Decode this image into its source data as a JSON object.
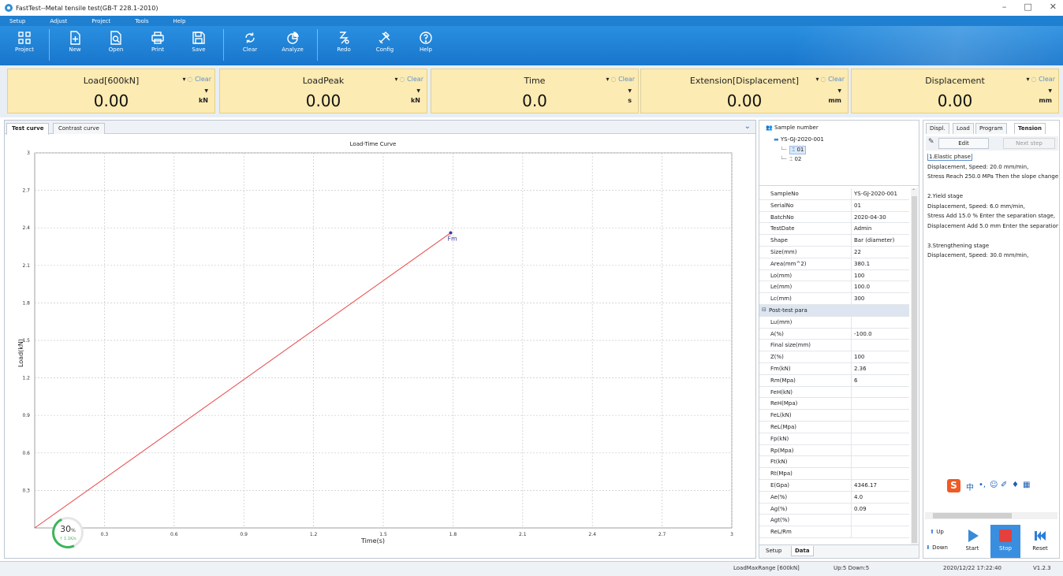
{
  "window": {
    "title": "FastTest--Metal tensile test(GB-T 228.1-2010)",
    "controls": [
      "–",
      "□",
      "✕"
    ]
  },
  "menu": [
    "Setup",
    "Adjust",
    "Project",
    "Tools",
    "Help"
  ],
  "toolbar": [
    {
      "label": "Project",
      "icon": "project-icon"
    },
    {
      "label": "New",
      "icon": "new-icon"
    },
    {
      "label": "Open",
      "icon": "open-icon"
    },
    {
      "label": "Print",
      "icon": "print-icon"
    },
    {
      "label": "Save",
      "icon": "save-icon"
    },
    {
      "label": "Clear",
      "icon": "clear-icon"
    },
    {
      "label": "Analyze",
      "icon": "analyze-icon"
    },
    {
      "label": "Redo",
      "icon": "redo-icon"
    },
    {
      "label": "Config",
      "icon": "config-icon"
    },
    {
      "label": "Help",
      "icon": "help-icon"
    }
  ],
  "panels": [
    {
      "name": "Load[600kN]",
      "value": "0.00",
      "unit": "kN",
      "clear": "Clear"
    },
    {
      "name": "LoadPeak",
      "value": "0.00",
      "unit": "kN",
      "clear": "Clear"
    },
    {
      "name": "Time",
      "value": "0.0",
      "unit": "s",
      "clear": "Clear"
    },
    {
      "name": "Extension[Displacement]",
      "value": "0.00",
      "unit": "mm",
      "clear": "Clear"
    },
    {
      "name": "Displacement",
      "value": "0.00",
      "unit": "mm",
      "clear": "Clear"
    }
  ],
  "left_tabs": [
    "Test curve",
    "Contrast curve"
  ],
  "chart_data": {
    "type": "line",
    "title": "Load-Time Curve",
    "xlabel": "Time(s)",
    "ylabel": "Load(kN)",
    "xlim": [
      0,
      3
    ],
    "ylim": [
      0,
      3
    ],
    "xticks": [
      "0.3",
      "0.6",
      "0.9",
      "1.2",
      "1.5",
      "1.8",
      "2.1",
      "2.4",
      "2.7",
      "3"
    ],
    "yticks": [
      "0.3",
      "0.6",
      "0.9",
      "1.2",
      "1.5",
      "1.8",
      "2.1",
      "2.4",
      "2.7",
      "3"
    ],
    "series": [
      {
        "color": "#e8494a",
        "x": [
          0,
          1.79
        ],
        "y": [
          0,
          2.36
        ]
      }
    ],
    "annotations": [
      {
        "label": "Fm",
        "x": 1.79,
        "y": 2.36,
        "color": "#3a3a9a"
      }
    ],
    "grid": true
  },
  "progress": {
    "percent": "30",
    "unit": "%",
    "rate": "↑ 1.1K/s"
  },
  "tree": {
    "root": "Sample number",
    "sample": "YS-GJ-2020-001",
    "items": [
      "01",
      "02"
    ]
  },
  "params": [
    {
      "k": "SampleNo",
      "v": "YS-GJ-2020-001"
    },
    {
      "k": "SerialNo",
      "v": "01"
    },
    {
      "k": "BatchNo",
      "v": "2020-04-30"
    },
    {
      "k": "TestDate",
      "v": "Admin"
    },
    {
      "k": "Shape",
      "v": "Bar (diameter)"
    },
    {
      "k": "Size(mm)",
      "v": "22"
    },
    {
      "k": "Area(mm^2)",
      "v": "380.1"
    },
    {
      "k": "Lo(mm)",
      "v": "100"
    },
    {
      "k": "Le(mm)",
      "v": "100.0"
    },
    {
      "k": "Lc(mm)",
      "v": "300"
    }
  ],
  "post_title": "Post-test para",
  "post": [
    {
      "k": "Lu(mm)",
      "v": ""
    },
    {
      "k": "A(%)",
      "v": "-100.0"
    },
    {
      "k": "Final size(mm)",
      "v": ""
    },
    {
      "k": "Z(%)",
      "v": "100"
    },
    {
      "k": "Fm(kN)",
      "v": "2.36"
    },
    {
      "k": "Rm(Mpa)",
      "v": "6"
    },
    {
      "k": "FeH(kN)",
      "v": ""
    },
    {
      "k": "ReH(Mpa)",
      "v": ""
    },
    {
      "k": "FeL(kN)",
      "v": ""
    },
    {
      "k": "ReL(Mpa)",
      "v": ""
    },
    {
      "k": "Fp(kN)",
      "v": ""
    },
    {
      "k": "Rp(Mpa)",
      "v": ""
    },
    {
      "k": "Ft(kN)",
      "v": ""
    },
    {
      "k": "Rt(Mpa)",
      "v": ""
    },
    {
      "k": "E(Gpa)",
      "v": "4346.17"
    },
    {
      "k": "Ae(%)",
      "v": "4.0"
    },
    {
      "k": "Ag(%)",
      "v": "0.09"
    },
    {
      "k": "Agt(%)",
      "v": ""
    },
    {
      "k": "ReL/Rm",
      "v": ""
    }
  ],
  "mid_tabs": [
    "Setup",
    "Data"
  ],
  "right_tabs": [
    "Displ.",
    "Load",
    "Program",
    "Tension"
  ],
  "edit_label": "Edit",
  "next_label": "Next step",
  "steps": [
    "1.Elastic phase",
    "Displacement, Speed: 20.0 mm/min,",
    "Stress Reach 250.0 MPa Then the slope change",
    "",
    "2.Yield stage",
    "Displacement, Speed: 6.0 mm/min,",
    "Stress Add 15.0 % Enter the separation stage,",
    "Displacement Add 5.0 mm Enter the separation",
    "",
    "3.Strengthening stage",
    "Displacement, Speed: 30.0 mm/min,"
  ],
  "controls": {
    "up": "Up",
    "down": "Down",
    "start": "Start",
    "stop": "Stop",
    "reset": "Reset"
  },
  "status": {
    "range": "LoadMaxRange [600kN]",
    "updown": "Up:5 Down:5",
    "datetime": "2020/12/22 17:22:40",
    "version": "V1.2.3"
  },
  "colors": {
    "accent": "#1f7fd0",
    "panel": "#fcebb2",
    "curve": "#e8494a",
    "stop": "#e5403c"
  }
}
